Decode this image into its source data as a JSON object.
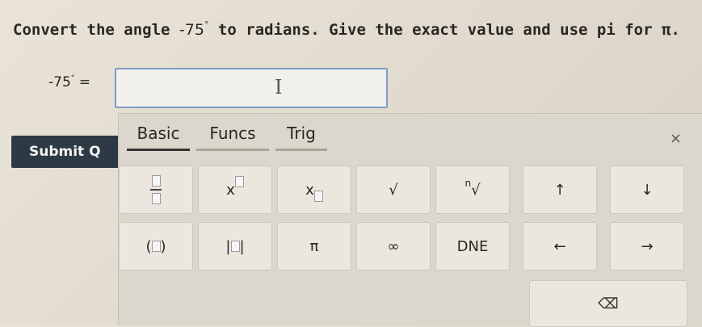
{
  "question": {
    "part1": "Convert the angle ",
    "angle": "-75",
    "deg": "°",
    "part2": " to radians. Give the exact value and use pi for ",
    "pi": "π."
  },
  "answer": {
    "label": "-75",
    "deg": "°",
    "equals": "=",
    "value": ""
  },
  "submit_label": "Submit Q",
  "keypad": {
    "tabs": [
      "Basic",
      "Funcs",
      "Trig"
    ],
    "active_tab": "Basic",
    "close": "×",
    "keys": {
      "x": "x",
      "sqrt": "√",
      "nthroot_index": "n",
      "nthroot": "√",
      "up": "↑",
      "down": "↓",
      "paren_open": "(",
      "paren_close": ")",
      "abs_bar": "|",
      "pi": "π",
      "infinity": "∞",
      "dne": "DNE",
      "left": "←",
      "right": "→",
      "backspace": "⌫"
    }
  }
}
